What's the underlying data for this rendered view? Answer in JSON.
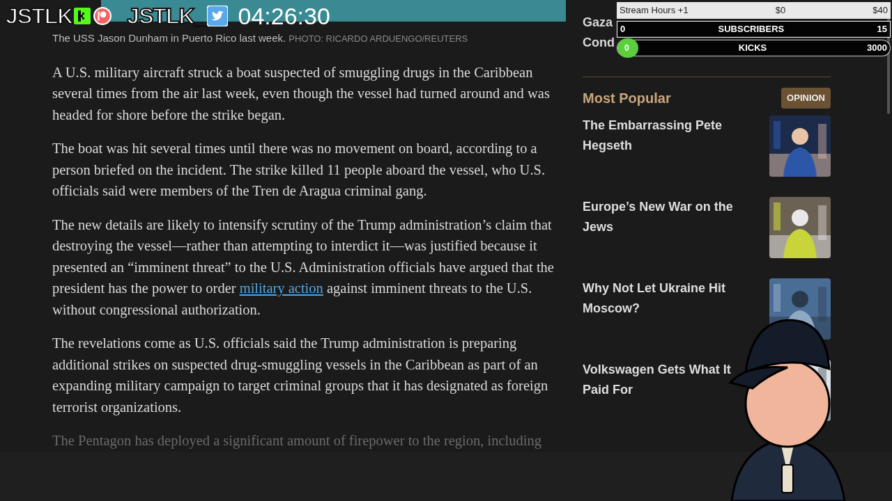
{
  "overlay": {
    "channels": [
      {
        "handle": "JSTLK",
        "kind": "kick"
      },
      {
        "handle": "JSTLK_",
        "kind": "twitter"
      }
    ],
    "timer": "04:26:30"
  },
  "caption": {
    "text": "The USS Jason Dunham in Puerto Rico last week.",
    "credit": "PHOTO: RICARDO ARDUENGO/REUTERS"
  },
  "paragraphs": [
    [
      {
        "kind": "text",
        "text": "A U.S. military aircraft struck a boat suspected of smuggling drugs in the Caribbean several times from the air last week, even though the vessel had turned around and was headed for shore before the strike began."
      }
    ],
    [
      {
        "kind": "text",
        "text": "The boat was hit several times until there was no movement on board, according to a person briefed on the incident. The strike killed 11 people aboard the vessel, who U.S. officials said were members of the Tren de Aragua criminal gang."
      }
    ],
    [
      {
        "kind": "text",
        "text": "The new details are likely to intensify scrutiny of the Trump administration’s claim that destroying the vessel—rather than attempting to interdict it—was justified because it presented an “imminent threat” to the U.S. Administration officials have argued that the president has the power to order "
      },
      {
        "kind": "link",
        "text": "military action"
      },
      {
        "kind": "text",
        "text": " against imminent threats to the U.S. without congressional authorization."
      }
    ],
    [
      {
        "kind": "text",
        "text": "The revelations come as U.S. officials said the Trump administration is preparing additional strikes on suspected drug-smuggling vessels in the Caribbean as part of an expanding military campaign to target criminal groups that it has designated as foreign terrorist organizations."
      }
    ],
    [
      {
        "kind": "text",
        "text": "The Pentagon has deployed a significant amount of firepower to the region, including"
      }
    ]
  ],
  "sidebar": {
    "top_headline": [
      "Gaza",
      "Cond"
    ],
    "section_title": "Most Popular",
    "badge": "OPINION",
    "items": [
      {
        "title": "The Embarrassing Pete Hegseth",
        "kind": "picture"
      },
      {
        "title": "Europe’s New War on the Jews",
        "kind": "picture"
      },
      {
        "title": "Why Not Let Ukraine Hit Moscow?",
        "kind": "picture"
      },
      {
        "title": "Volkswagen Gets What It Paid For",
        "kind": "picture"
      }
    ]
  },
  "goals": [
    {
      "kind": "plain",
      "label": "Stream Hours +1",
      "start": "$0",
      "target": "$40"
    },
    {
      "kind": "boxed",
      "label": "SUBSCRIBERS",
      "start": "0",
      "target": "15"
    },
    {
      "kind": "pill",
      "label": "KICKS",
      "start": "0",
      "target": "3000",
      "level": 0
    }
  ]
}
